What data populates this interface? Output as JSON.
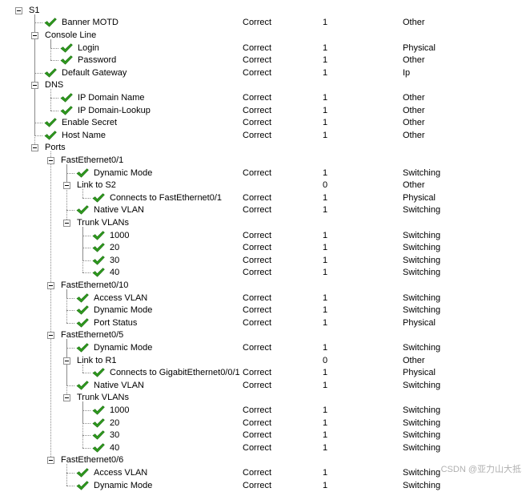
{
  "tree": [
    {
      "label": "S1",
      "level": 0,
      "expanded": true,
      "icon": "minus-expander"
    },
    {
      "label": "Banner MOTD",
      "level": 1,
      "status": "Correct",
      "points": "1",
      "type": "Other",
      "icon": "green-check"
    },
    {
      "label": "Console Line",
      "level": 1,
      "expanded": true,
      "icon": "minus-expander"
    },
    {
      "label": "Login",
      "level": 2,
      "status": "Correct",
      "points": "1",
      "type": "Physical",
      "icon": "green-check"
    },
    {
      "label": "Password",
      "level": 2,
      "status": "Correct",
      "points": "1",
      "type": "Other",
      "icon": "green-check"
    },
    {
      "label": "Default Gateway",
      "level": 1,
      "status": "Correct",
      "points": "1",
      "type": "Ip",
      "icon": "green-check"
    },
    {
      "label": "DNS",
      "level": 1,
      "expanded": true,
      "icon": "minus-expander"
    },
    {
      "label": "IP Domain Name",
      "level": 2,
      "status": "Correct",
      "points": "1",
      "type": "Other",
      "icon": "green-check"
    },
    {
      "label": "IP Domain-Lookup",
      "level": 2,
      "status": "Correct",
      "points": "1",
      "type": "Other",
      "icon": "green-check"
    },
    {
      "label": "Enable Secret",
      "level": 1,
      "status": "Correct",
      "points": "1",
      "type": "Other",
      "icon": "green-check"
    },
    {
      "label": "Host Name",
      "level": 1,
      "status": "Correct",
      "points": "1",
      "type": "Other",
      "icon": "green-check"
    },
    {
      "label": "Ports",
      "level": 1,
      "expanded": true,
      "icon": "minus-expander"
    },
    {
      "label": "FastEthernet0/1",
      "level": 2,
      "expanded": true,
      "icon": "minus-expander"
    },
    {
      "label": "Dynamic Mode",
      "level": 3,
      "status": "Correct",
      "points": "1",
      "type": "Switching",
      "icon": "green-check"
    },
    {
      "label": "Link to S2",
      "level": 3,
      "expanded": true,
      "points": "0",
      "type": "Other",
      "icon": "minus-expander"
    },
    {
      "label": "Connects to FastEthernet0/1",
      "level": 4,
      "status": "Correct",
      "points": "1",
      "type": "Physical",
      "icon": "green-check"
    },
    {
      "label": "Native VLAN",
      "level": 3,
      "status": "Correct",
      "points": "1",
      "type": "Switching",
      "icon": "green-check"
    },
    {
      "label": "Trunk VLANs",
      "level": 3,
      "expanded": true,
      "icon": "minus-expander"
    },
    {
      "label": "1000",
      "level": 4,
      "status": "Correct",
      "points": "1",
      "type": "Switching",
      "icon": "green-check"
    },
    {
      "label": "20",
      "level": 4,
      "status": "Correct",
      "points": "1",
      "type": "Switching",
      "icon": "green-check"
    },
    {
      "label": "30",
      "level": 4,
      "status": "Correct",
      "points": "1",
      "type": "Switching",
      "icon": "green-check"
    },
    {
      "label": "40",
      "level": 4,
      "status": "Correct",
      "points": "1",
      "type": "Switching",
      "icon": "green-check"
    },
    {
      "label": "FastEthernet0/10",
      "level": 2,
      "expanded": true,
      "icon": "minus-expander"
    },
    {
      "label": "Access VLAN",
      "level": 3,
      "status": "Correct",
      "points": "1",
      "type": "Switching",
      "icon": "green-check"
    },
    {
      "label": "Dynamic Mode",
      "level": 3,
      "status": "Correct",
      "points": "1",
      "type": "Switching",
      "icon": "green-check"
    },
    {
      "label": "Port Status",
      "level": 3,
      "status": "Correct",
      "points": "1",
      "type": "Physical",
      "icon": "green-check"
    },
    {
      "label": "FastEthernet0/5",
      "level": 2,
      "expanded": true,
      "icon": "minus-expander"
    },
    {
      "label": "Dynamic Mode",
      "level": 3,
      "status": "Correct",
      "points": "1",
      "type": "Switching",
      "icon": "green-check"
    },
    {
      "label": "Link to R1",
      "level": 3,
      "expanded": true,
      "points": "0",
      "type": "Other",
      "icon": "minus-expander"
    },
    {
      "label": "Connects to GigabitEthernet0/0/1",
      "level": 4,
      "status": "Correct",
      "points": "1",
      "type": "Physical",
      "icon": "green-check"
    },
    {
      "label": "Native VLAN",
      "level": 3,
      "status": "Correct",
      "points": "1",
      "type": "Switching",
      "icon": "green-check"
    },
    {
      "label": "Trunk VLANs",
      "level": 3,
      "expanded": true,
      "icon": "minus-expander"
    },
    {
      "label": "1000",
      "level": 4,
      "status": "Correct",
      "points": "1",
      "type": "Switching",
      "icon": "green-check"
    },
    {
      "label": "20",
      "level": 4,
      "status": "Correct",
      "points": "1",
      "type": "Switching",
      "icon": "green-check"
    },
    {
      "label": "30",
      "level": 4,
      "status": "Correct",
      "points": "1",
      "type": "Switching",
      "icon": "green-check"
    },
    {
      "label": "40",
      "level": 4,
      "status": "Correct",
      "points": "1",
      "type": "Switching",
      "icon": "green-check"
    },
    {
      "label": "FastEthernet0/6",
      "level": 2,
      "expanded": true,
      "icon": "minus-expander"
    },
    {
      "label": "Access VLAN",
      "level": 3,
      "status": "Correct",
      "points": "1",
      "type": "Switching",
      "icon": "green-check"
    },
    {
      "label": "Dynamic Mode",
      "level": 3,
      "status": "Correct",
      "points": "1",
      "type": "Switching",
      "icon": "green-check"
    }
  ],
  "watermark": "CSDN @亚力山大抵",
  "colors": {
    "check": "#2e9a1e",
    "check_dark": "#1b6d10",
    "tree_lines": "#8a8a8a"
  }
}
